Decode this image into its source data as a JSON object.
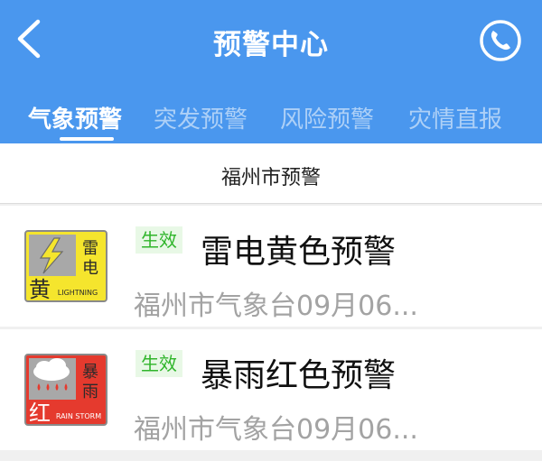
{
  "header": {
    "title": "预警中心",
    "back_icon": "chevron-left-icon",
    "phone_icon": "phone-icon",
    "bg_color": "#4a97ee"
  },
  "tabs": [
    {
      "label": "气象预警",
      "active": true
    },
    {
      "label": "突发预警",
      "active": false
    },
    {
      "label": "风险预警",
      "active": false
    },
    {
      "label": "灾情直报",
      "active": false
    }
  ],
  "region": {
    "label": "福州市预警"
  },
  "warnings": [
    {
      "status": "生效",
      "title": "雷电黄色预警",
      "issuer": "福州市气象台09月06...",
      "badge": {
        "level": "黄",
        "type_chars": [
          "雷",
          "电"
        ],
        "english": "LIGHTNING",
        "icon": "lightning-icon",
        "color": "#f5e52d"
      }
    },
    {
      "status": "生效",
      "title": "暴雨红色预警",
      "issuer": "福州市气象台09月06...",
      "badge": {
        "level": "红",
        "type_chars": [
          "暴",
          "雨"
        ],
        "english": "RAIN STORM",
        "icon": "rainstorm-icon",
        "color": "#e53a2e"
      }
    }
  ]
}
